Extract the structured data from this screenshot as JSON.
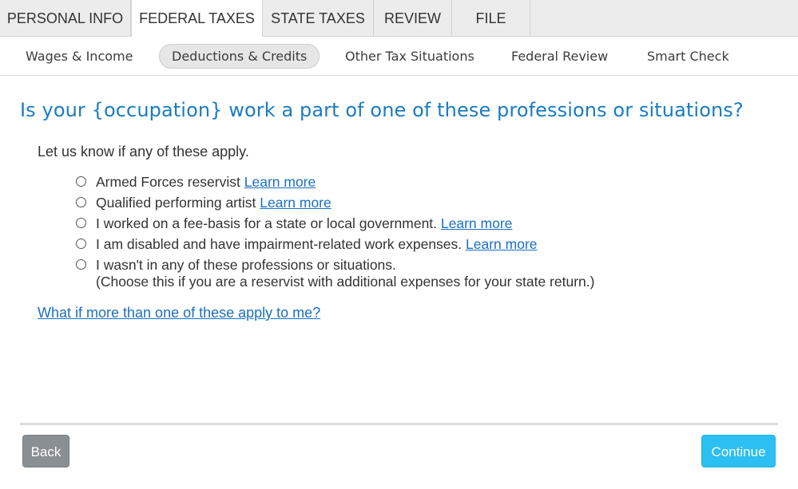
{
  "main_tabs": {
    "personal": "PERSONAL INFO",
    "federal": "FEDERAL TAXES",
    "state": "STATE TAXES",
    "review": "REVIEW",
    "file": "FILE"
  },
  "sub_tabs": {
    "wages": "Wages & Income",
    "deductions": "Deductions & Credits",
    "other": "Other Tax Situations",
    "federal_review": "Federal Review",
    "smart_check": "Smart Check"
  },
  "content": {
    "title": "Is your {occupation} work a part of one of these professions or situations?",
    "intro": "Let us know if any of these apply.",
    "learn_more": "Learn more",
    "options": [
      {
        "label": "Armed Forces reservist"
      },
      {
        "label": "Qualified performing artist"
      },
      {
        "label": "I worked on a fee-basis for a state or local government."
      },
      {
        "label": "I am disabled and have impairment-related work expenses."
      },
      {
        "label": "I wasn't in any of these professions or situations.",
        "note": "(Choose this if you are a reservist with additional expenses for your state return.)"
      }
    ],
    "help_link": "What if more than one of these apply to me?"
  },
  "buttons": {
    "back": "Back",
    "continue": "Continue"
  },
  "colors": {
    "title_blue": "#1a7cc1",
    "link_blue": "#1a6fc4",
    "continue_button": "#2bc0f1",
    "back_button": "#8a8f93"
  }
}
